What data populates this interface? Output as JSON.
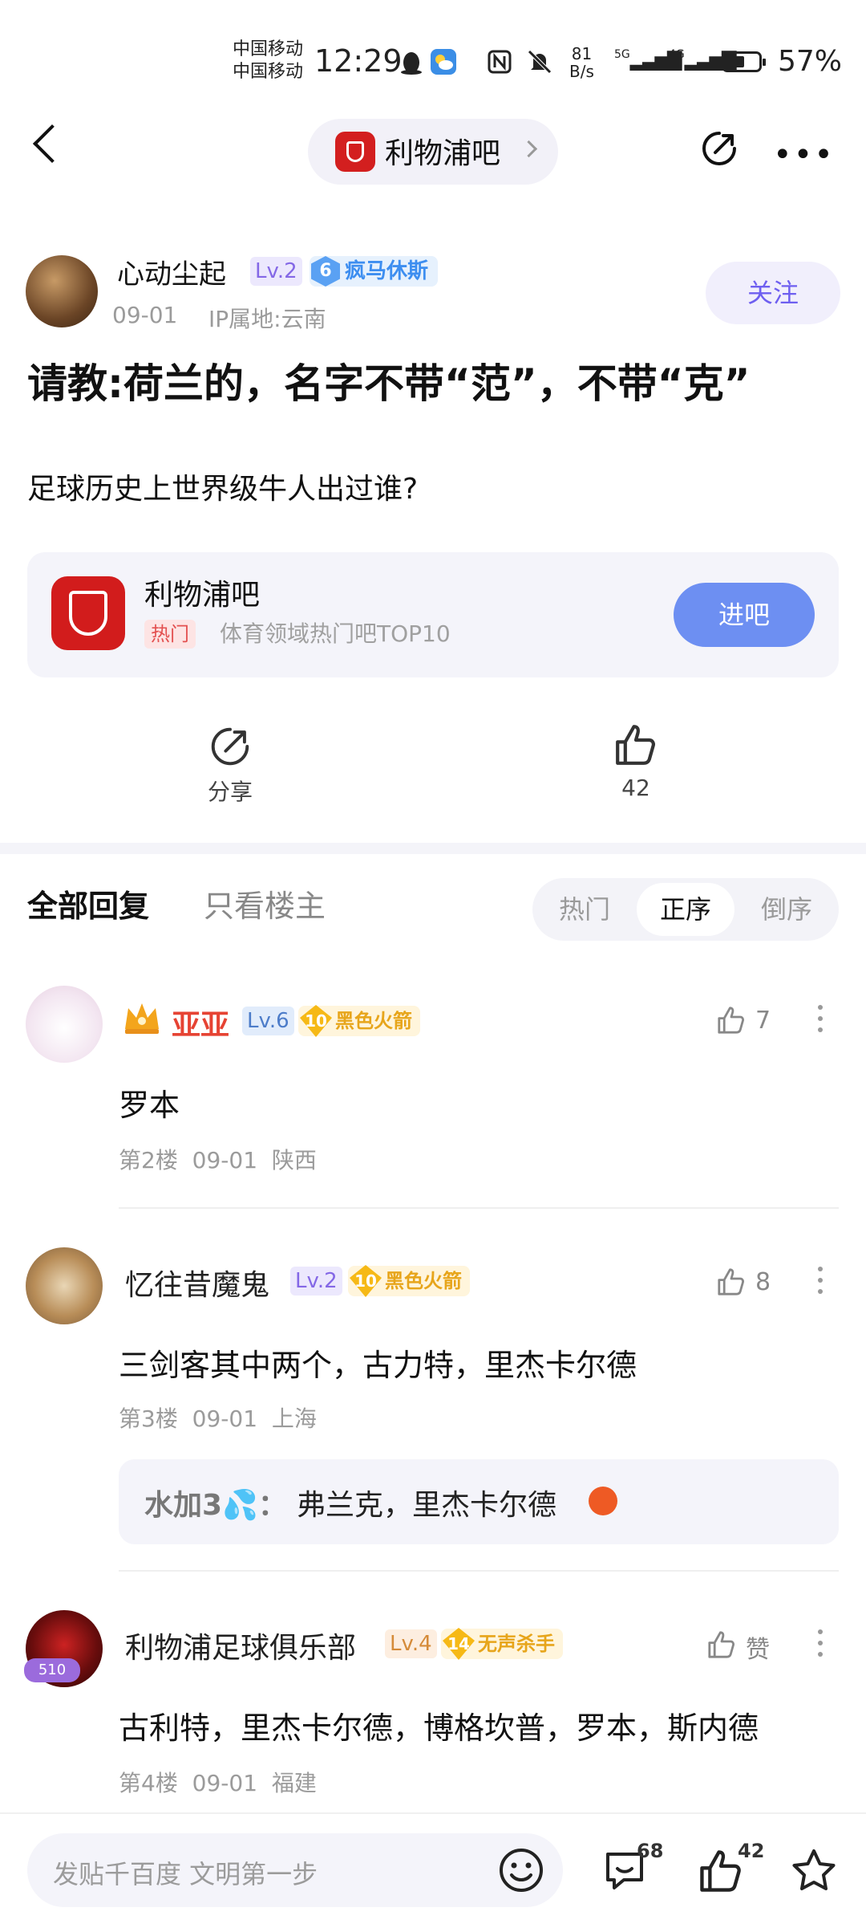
{
  "status_bar": {
    "carrier_1": "中国移动",
    "carrier_2": "中国移动",
    "time": "12:29",
    "net_speed_value": "81",
    "net_speed_unit": "B/s",
    "signal_1": "5G",
    "signal_2": "4G",
    "battery": "57%",
    "battery_level": 0.57
  },
  "header": {
    "forum_name": "利物浦吧"
  },
  "post": {
    "author": {
      "name": "心动尘起",
      "level": "Lv.2",
      "badge_num": "6",
      "badge_text": "疯马休斯",
      "date": "09-01",
      "ip": "IP属地:云南"
    },
    "follow_label": "关注",
    "title": "请教:荷兰的，名字不带“范”，不带“克”",
    "body": "足球历史上世界级牛人出过谁?",
    "forum_card": {
      "name": "利物浦吧",
      "tag": "热门",
      "desc": "体育领域热门吧TOP10",
      "button": "进吧"
    },
    "actions": {
      "share_label": "分享",
      "like_count": "42"
    }
  },
  "replies_header": {
    "tab_all": "全部回复",
    "tab_op": "只看楼主",
    "sort": [
      "热门",
      "正序",
      "倒序"
    ]
  },
  "replies": [
    {
      "name": "亚亚",
      "level": "Lv.6",
      "badge_num": "10",
      "badge_text": "黑色火箭",
      "likes": "7",
      "text": "罗本",
      "floor": "第2楼",
      "date": "09-01",
      "location": "陕西"
    },
    {
      "name": "忆往昔魔鬼",
      "level": "Lv.2",
      "badge_num": "10",
      "badge_text": "黑色火箭",
      "likes": "8",
      "text": "三剑客其中两个，古力特，里杰卡尔德",
      "floor": "第3楼",
      "date": "09-01",
      "location": "上海",
      "sub_reply": {
        "user": "水加3💦",
        "sep": "：",
        "text": "弗兰克，里杰卡尔德"
      }
    },
    {
      "name": "利物浦足球俱乐部",
      "level": "Lv.4",
      "badge_num": "14",
      "badge_text": "无声杀手",
      "likes": "赞",
      "text": "古利特，里杰卡尔德，博格坎普，罗本，斯内德",
      "floor": "第4楼",
      "date": "09-01",
      "location": "福建",
      "pendant": "510"
    }
  ],
  "bottom_bar": {
    "placeholder": "发贴千百度 文明第一步",
    "comment_count": "68",
    "like_count": "42"
  },
  "colors": {
    "accent": "#6d8ff2",
    "follow_text": "#6e5ff0",
    "red_name": "#e64333",
    "badge_gold": "#f6b916"
  }
}
